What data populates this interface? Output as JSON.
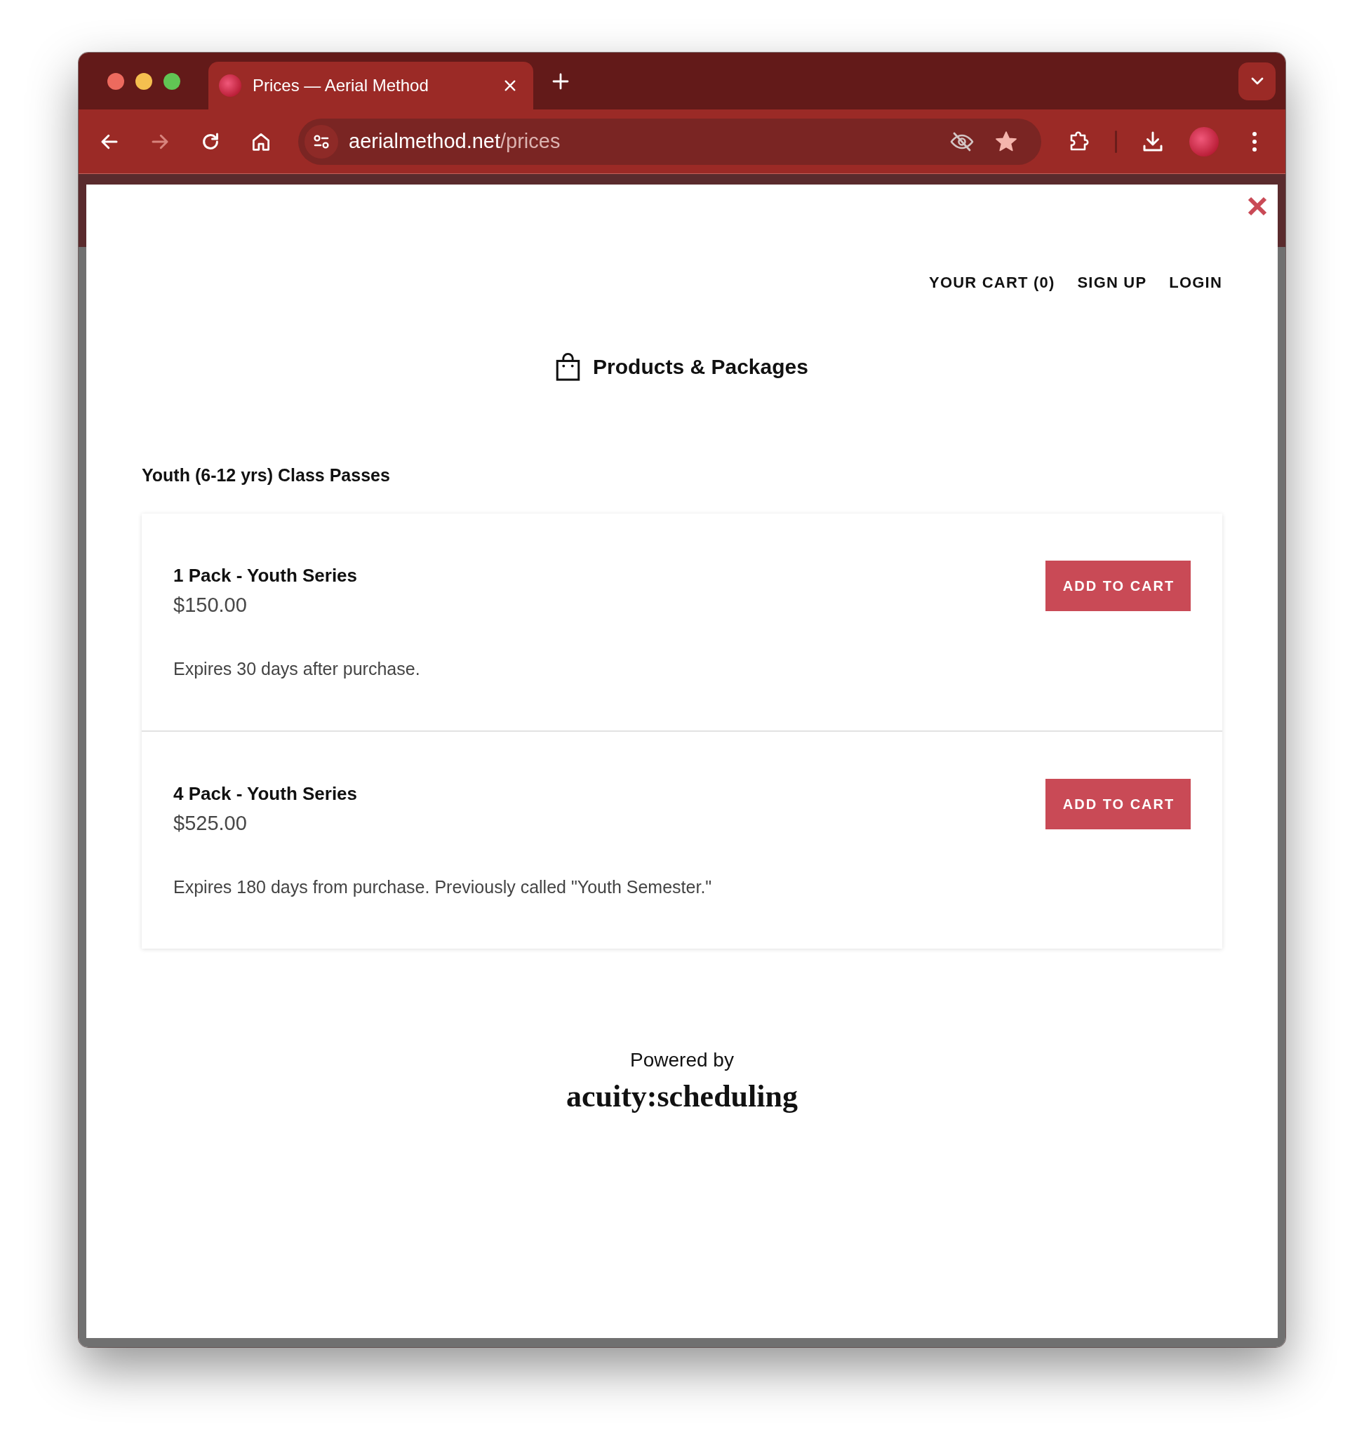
{
  "tabs": [
    {
      "title": "Prices — Aerial Method",
      "selected": true
    }
  ],
  "toolbar": {
    "nav_buttons": [
      {
        "kind": "back",
        "disabled": false
      },
      {
        "kind": "forward",
        "disabled": true
      },
      {
        "kind": "reload",
        "disabled": false
      },
      {
        "kind": "home",
        "disabled": false
      }
    ],
    "address_bar": {
      "domain": "aerialmethod.net",
      "path": "/prices",
      "bookmarked": true
    }
  },
  "page": {
    "nav_links": [
      {
        "label": "YOUR CART (0)"
      },
      {
        "label": "SIGN UP"
      },
      {
        "label": "LOGIN"
      }
    ],
    "heading": "Products & Packages",
    "sections": [
      {
        "title": "Youth (6-12 yrs) Class Passes",
        "products": [
          {
            "name": "1 Pack - Youth Series",
            "price": "$150.00",
            "description": "Expires 30 days after purchase.",
            "button": "ADD TO CART"
          },
          {
            "name": "4 Pack - Youth Series",
            "price": "$525.00",
            "description": "Expires 180 days from purchase. Previously called \"Youth Semester.\"",
            "button": "ADD TO CART"
          }
        ]
      }
    ],
    "footer": {
      "powered_by": "Powered by",
      "logo": "acuity:scheduling"
    }
  }
}
